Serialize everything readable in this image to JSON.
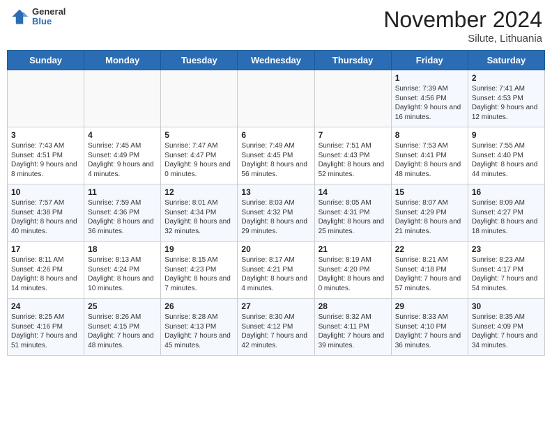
{
  "header": {
    "logo": {
      "general": "General",
      "blue": "Blue"
    },
    "title": "November 2024",
    "location": "Silute, Lithuania"
  },
  "calendar": {
    "headers": [
      "Sunday",
      "Monday",
      "Tuesday",
      "Wednesday",
      "Thursday",
      "Friday",
      "Saturday"
    ],
    "weeks": [
      [
        {
          "day": "",
          "info": ""
        },
        {
          "day": "",
          "info": ""
        },
        {
          "day": "",
          "info": ""
        },
        {
          "day": "",
          "info": ""
        },
        {
          "day": "",
          "info": ""
        },
        {
          "day": "1",
          "info": "Sunrise: 7:39 AM\nSunset: 4:56 PM\nDaylight: 9 hours and 16 minutes."
        },
        {
          "day": "2",
          "info": "Sunrise: 7:41 AM\nSunset: 4:53 PM\nDaylight: 9 hours and 12 minutes."
        }
      ],
      [
        {
          "day": "3",
          "info": "Sunrise: 7:43 AM\nSunset: 4:51 PM\nDaylight: 9 hours and 8 minutes."
        },
        {
          "day": "4",
          "info": "Sunrise: 7:45 AM\nSunset: 4:49 PM\nDaylight: 9 hours and 4 minutes."
        },
        {
          "day": "5",
          "info": "Sunrise: 7:47 AM\nSunset: 4:47 PM\nDaylight: 9 hours and 0 minutes."
        },
        {
          "day": "6",
          "info": "Sunrise: 7:49 AM\nSunset: 4:45 PM\nDaylight: 8 hours and 56 minutes."
        },
        {
          "day": "7",
          "info": "Sunrise: 7:51 AM\nSunset: 4:43 PM\nDaylight: 8 hours and 52 minutes."
        },
        {
          "day": "8",
          "info": "Sunrise: 7:53 AM\nSunset: 4:41 PM\nDaylight: 8 hours and 48 minutes."
        },
        {
          "day": "9",
          "info": "Sunrise: 7:55 AM\nSunset: 4:40 PM\nDaylight: 8 hours and 44 minutes."
        }
      ],
      [
        {
          "day": "10",
          "info": "Sunrise: 7:57 AM\nSunset: 4:38 PM\nDaylight: 8 hours and 40 minutes."
        },
        {
          "day": "11",
          "info": "Sunrise: 7:59 AM\nSunset: 4:36 PM\nDaylight: 8 hours and 36 minutes."
        },
        {
          "day": "12",
          "info": "Sunrise: 8:01 AM\nSunset: 4:34 PM\nDaylight: 8 hours and 32 minutes."
        },
        {
          "day": "13",
          "info": "Sunrise: 8:03 AM\nSunset: 4:32 PM\nDaylight: 8 hours and 29 minutes."
        },
        {
          "day": "14",
          "info": "Sunrise: 8:05 AM\nSunset: 4:31 PM\nDaylight: 8 hours and 25 minutes."
        },
        {
          "day": "15",
          "info": "Sunrise: 8:07 AM\nSunset: 4:29 PM\nDaylight: 8 hours and 21 minutes."
        },
        {
          "day": "16",
          "info": "Sunrise: 8:09 AM\nSunset: 4:27 PM\nDaylight: 8 hours and 18 minutes."
        }
      ],
      [
        {
          "day": "17",
          "info": "Sunrise: 8:11 AM\nSunset: 4:26 PM\nDaylight: 8 hours and 14 minutes."
        },
        {
          "day": "18",
          "info": "Sunrise: 8:13 AM\nSunset: 4:24 PM\nDaylight: 8 hours and 10 minutes."
        },
        {
          "day": "19",
          "info": "Sunrise: 8:15 AM\nSunset: 4:23 PM\nDaylight: 8 hours and 7 minutes."
        },
        {
          "day": "20",
          "info": "Sunrise: 8:17 AM\nSunset: 4:21 PM\nDaylight: 8 hours and 4 minutes."
        },
        {
          "day": "21",
          "info": "Sunrise: 8:19 AM\nSunset: 4:20 PM\nDaylight: 8 hours and 0 minutes."
        },
        {
          "day": "22",
          "info": "Sunrise: 8:21 AM\nSunset: 4:18 PM\nDaylight: 7 hours and 57 minutes."
        },
        {
          "day": "23",
          "info": "Sunrise: 8:23 AM\nSunset: 4:17 PM\nDaylight: 7 hours and 54 minutes."
        }
      ],
      [
        {
          "day": "24",
          "info": "Sunrise: 8:25 AM\nSunset: 4:16 PM\nDaylight: 7 hours and 51 minutes."
        },
        {
          "day": "25",
          "info": "Sunrise: 8:26 AM\nSunset: 4:15 PM\nDaylight: 7 hours and 48 minutes."
        },
        {
          "day": "26",
          "info": "Sunrise: 8:28 AM\nSunset: 4:13 PM\nDaylight: 7 hours and 45 minutes."
        },
        {
          "day": "27",
          "info": "Sunrise: 8:30 AM\nSunset: 4:12 PM\nDaylight: 7 hours and 42 minutes."
        },
        {
          "day": "28",
          "info": "Sunrise: 8:32 AM\nSunset: 4:11 PM\nDaylight: 7 hours and 39 minutes."
        },
        {
          "day": "29",
          "info": "Sunrise: 8:33 AM\nSunset: 4:10 PM\nDaylight: 7 hours and 36 minutes."
        },
        {
          "day": "30",
          "info": "Sunrise: 8:35 AM\nSunset: 4:09 PM\nDaylight: 7 hours and 34 minutes."
        }
      ]
    ]
  }
}
